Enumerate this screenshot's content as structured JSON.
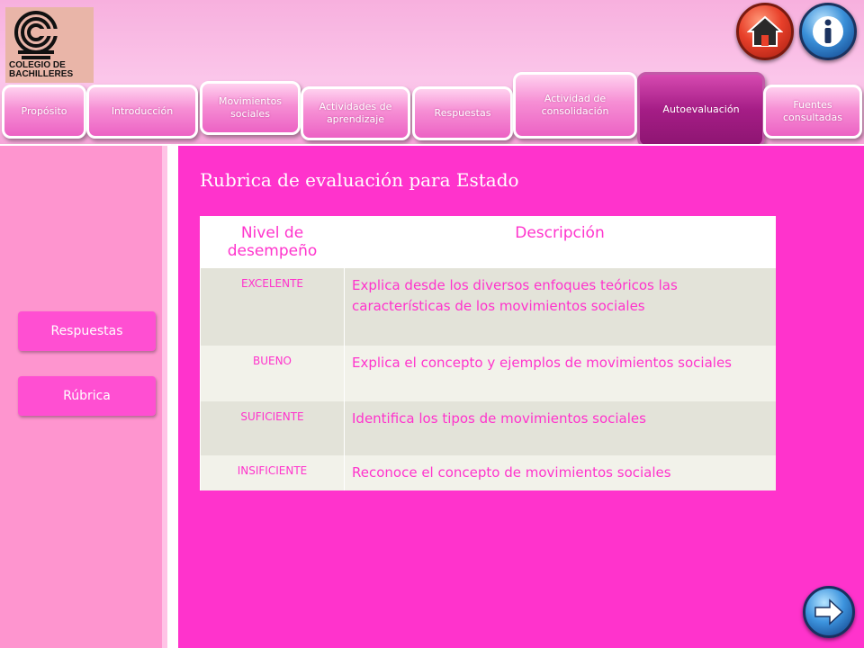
{
  "header": {
    "logo_text_line1": "COLEGIO DE",
    "logo_text_line2": "BACHILLERES"
  },
  "nav": {
    "tabs": [
      {
        "label": "Propósito"
      },
      {
        "label": "Introducción"
      },
      {
        "label": "Movimientos sociales"
      },
      {
        "label": "Actividades de aprendizaje"
      },
      {
        "label": "Respuestas"
      },
      {
        "label": "Actividad de consolidación"
      },
      {
        "label": "Autoevaluación",
        "active": true
      },
      {
        "label": "Fuentes consultadas"
      }
    ],
    "home_icon": "home-icon",
    "info_icon": "info-icon"
  },
  "sidebar": {
    "items": [
      {
        "label": "Respuestas"
      },
      {
        "label": "Rúbrica"
      }
    ]
  },
  "main": {
    "title": "Rubrica de evaluación para Estado",
    "table": {
      "headers": [
        "Nivel de desempeño",
        "Descripción"
      ],
      "rows": [
        {
          "level": "EXCELENTE",
          "description": "Explica desde los diversos enfoques teóricos las características de los movimientos sociales"
        },
        {
          "level": "BUENO",
          "description": "Explica el concepto y ejemplos de movimientos sociales"
        },
        {
          "level": "SUFICIENTE",
          "description": "Identifica los tipos de movimientos sociales"
        },
        {
          "level": "INSIFICIENTE",
          "description": "Reconoce el concepto de movimientos sociales"
        }
      ]
    }
  },
  "footer": {
    "next_icon": "arrow-right-icon"
  },
  "colors": {
    "accent": "#ff33cc",
    "sidebar_bg": "#fe95cf",
    "button": "#ff4fd2",
    "active_tab": "#a51d86"
  }
}
